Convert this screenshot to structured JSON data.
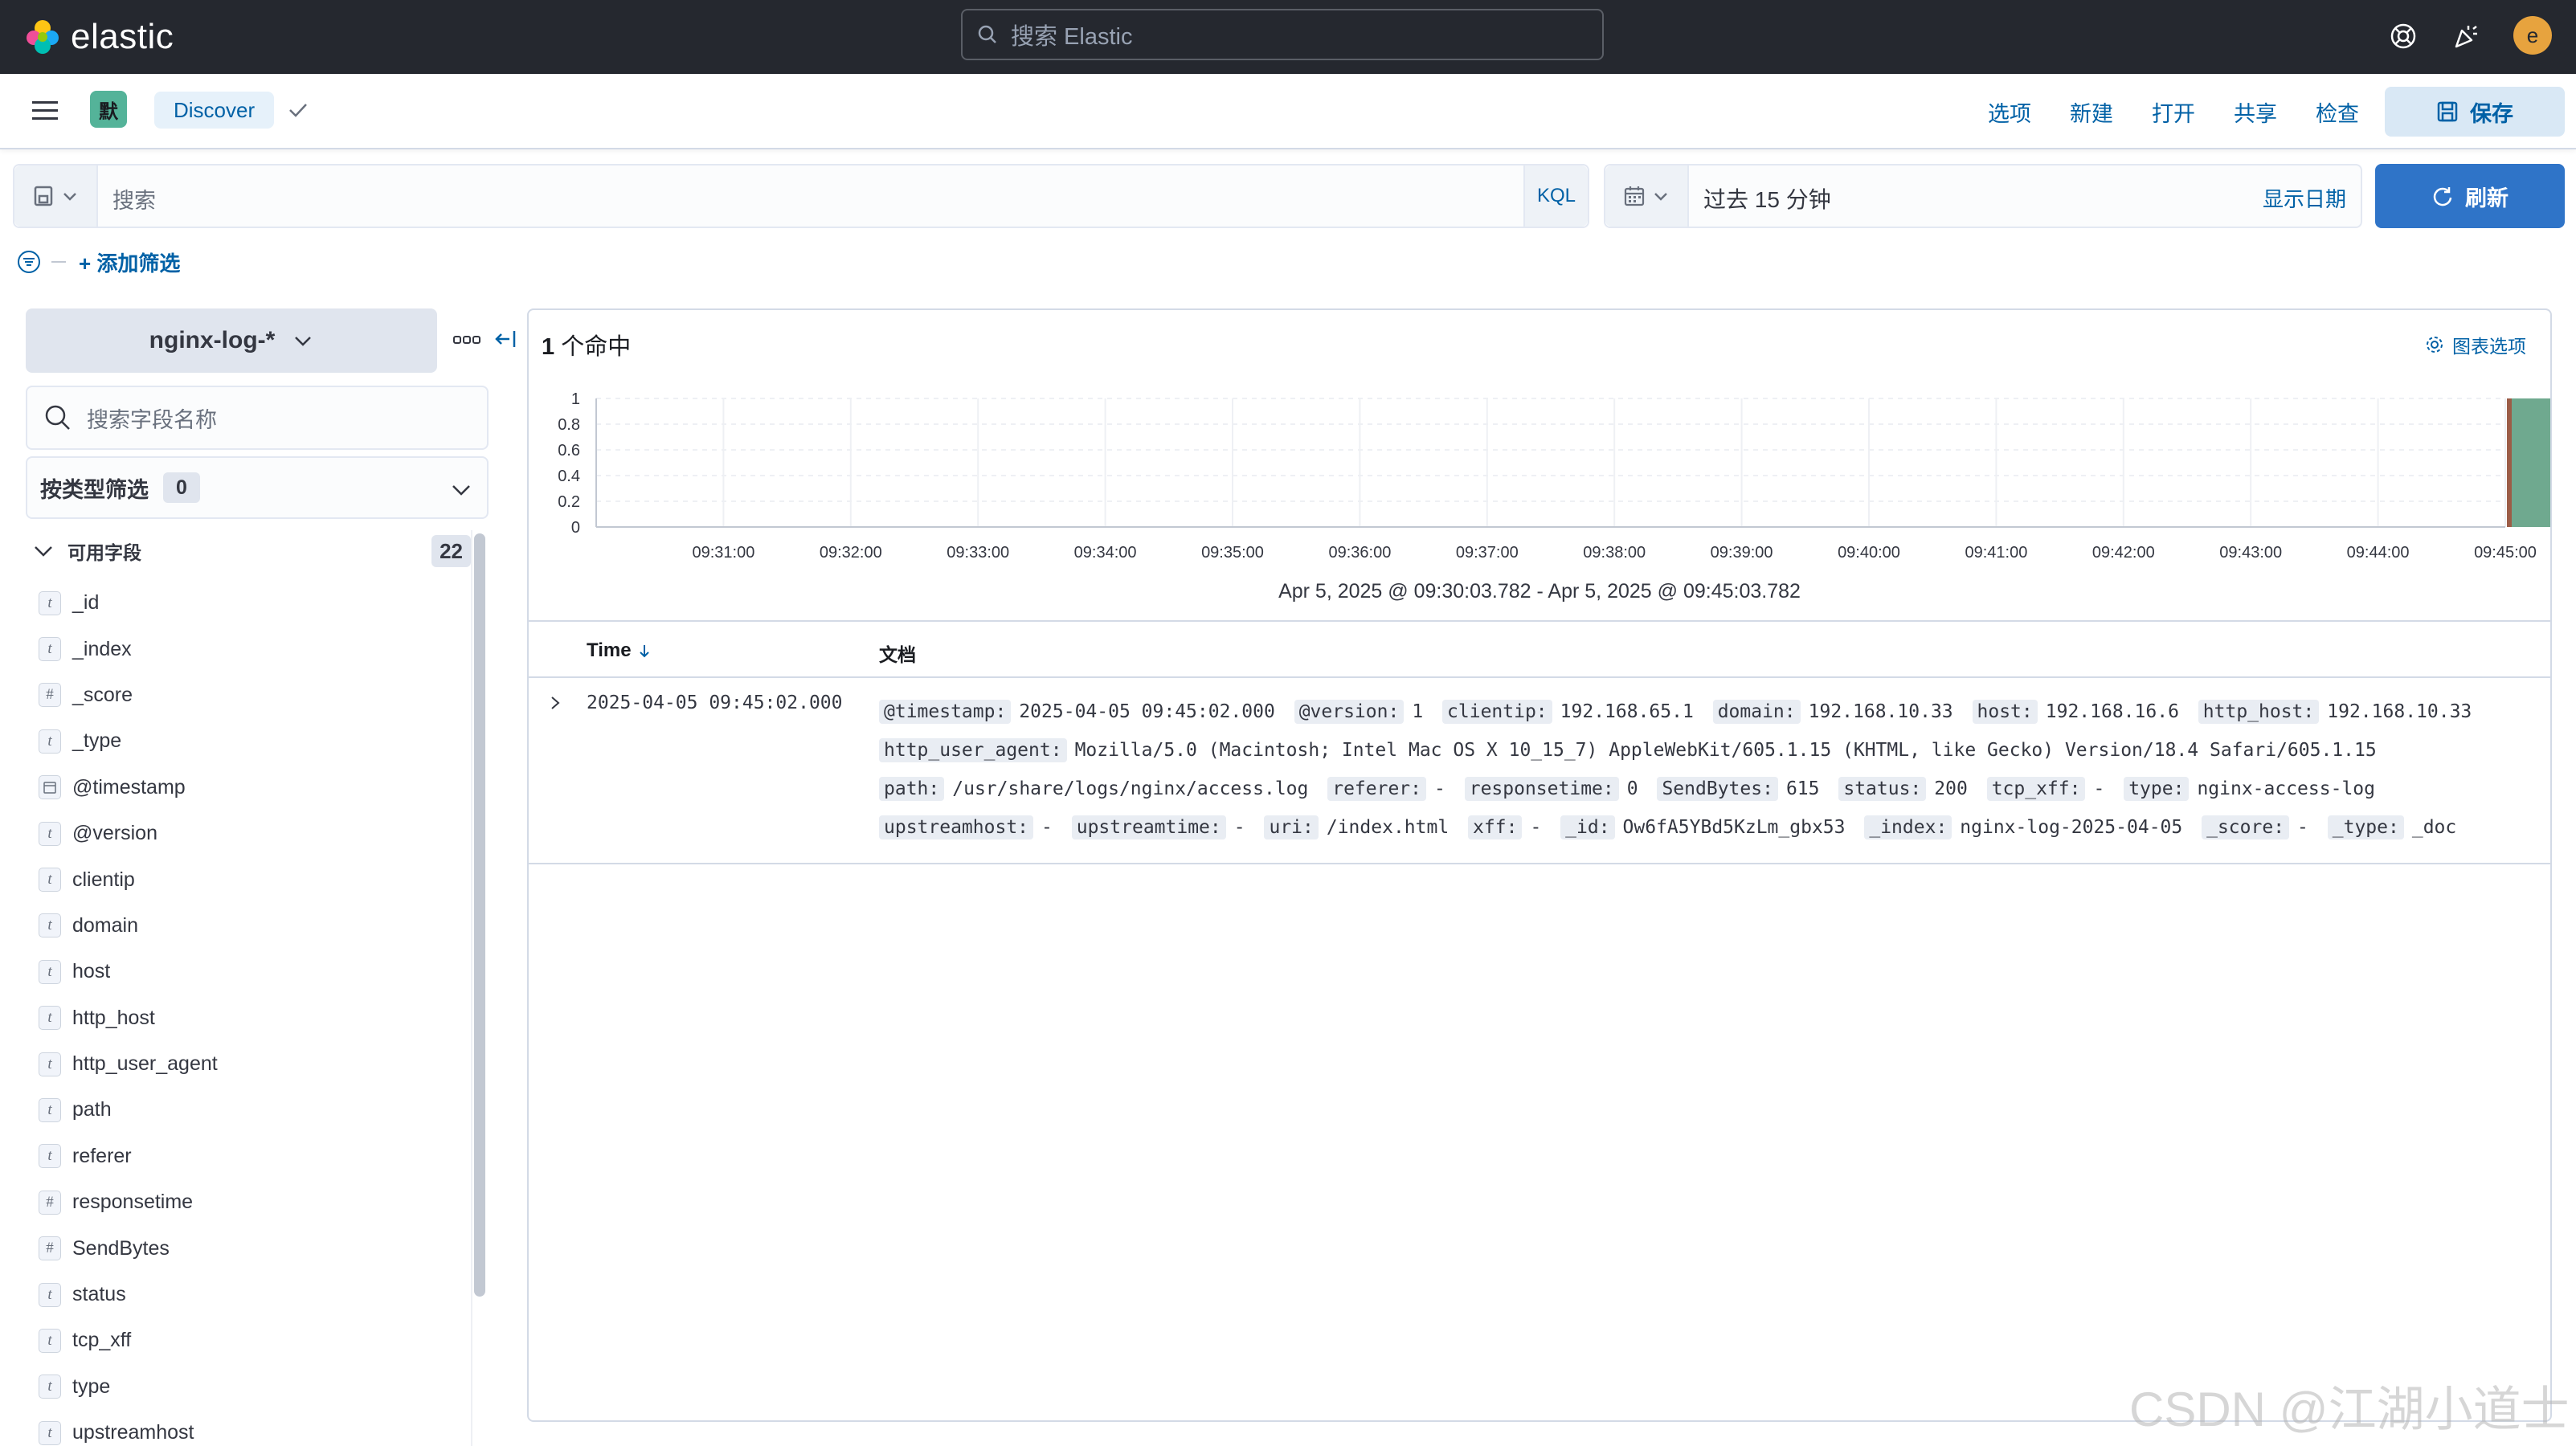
{
  "header": {
    "brand": "elastic",
    "search_placeholder": "搜索 Elastic",
    "avatar_initial": "e"
  },
  "appbar": {
    "space_initial": "默",
    "breadcrumb": "Discover",
    "menu": [
      "选项",
      "新建",
      "打开",
      "共享",
      "检查"
    ],
    "save_label": "保存"
  },
  "querybar": {
    "placeholder": "搜索",
    "language": "KQL",
    "time_range": "过去 15 分钟",
    "show_dates": "显示日期",
    "refresh_label": "刷新",
    "add_filter": "+ 添加筛选"
  },
  "sidebar": {
    "index_pattern": "nginx-log-*",
    "field_search_placeholder": "搜索字段名称",
    "type_filter_label": "按类型筛选",
    "type_filter_count": "0",
    "available_fields_label": "可用字段",
    "available_fields_count": "22",
    "fields": [
      {
        "type": "t",
        "name": "_id"
      },
      {
        "type": "t",
        "name": "_index"
      },
      {
        "type": "#",
        "name": "_score"
      },
      {
        "type": "t",
        "name": "_type"
      },
      {
        "type": "date",
        "name": "@timestamp"
      },
      {
        "type": "t",
        "name": "@version"
      },
      {
        "type": "t",
        "name": "clientip"
      },
      {
        "type": "t",
        "name": "domain"
      },
      {
        "type": "t",
        "name": "host"
      },
      {
        "type": "t",
        "name": "http_host"
      },
      {
        "type": "t",
        "name": "http_user_agent"
      },
      {
        "type": "t",
        "name": "path"
      },
      {
        "type": "t",
        "name": "referer"
      },
      {
        "type": "#",
        "name": "responsetime"
      },
      {
        "type": "#",
        "name": "SendBytes"
      },
      {
        "type": "t",
        "name": "status"
      },
      {
        "type": "t",
        "name": "tcp_xff"
      },
      {
        "type": "t",
        "name": "type"
      },
      {
        "type": "t",
        "name": "upstreamhost"
      }
    ]
  },
  "main": {
    "hits_count": "1",
    "hits_label": " 个命中",
    "chart_options": "图表选项",
    "time_range_text": "Apr 5, 2025 @ 09:30:03.782 - Apr 5, 2025 @ 09:45:03.782",
    "table": {
      "col_time": "Time",
      "col_doc": "文档",
      "rows": [
        {
          "time": "2025-04-05 09:45:02.000",
          "fields": [
            {
              "k": "@timestamp:",
              "v": "2025-04-05 09:45:02.000"
            },
            {
              "k": "@version:",
              "v": "1"
            },
            {
              "k": "clientip:",
              "v": "192.168.65.1"
            },
            {
              "k": "domain:",
              "v": "192.168.10.33"
            },
            {
              "k": "host:",
              "v": "192.168.16.6"
            },
            {
              "k": "http_host:",
              "v": "192.168.10.33"
            },
            {
              "k": "http_user_agent:",
              "v": "Mozilla/5.0 (Macintosh; Intel Mac OS X 10_15_7) AppleWebKit/605.1.15 (KHTML, like Gecko) Version/18.4 Safari/605.1.15"
            },
            {
              "k": "path:",
              "v": "/usr/share/logs/nginx/access.log"
            },
            {
              "k": "referer:",
              "v": "-"
            },
            {
              "k": "responsetime:",
              "v": "0"
            },
            {
              "k": "SendBytes:",
              "v": "615"
            },
            {
              "k": "status:",
              "v": "200"
            },
            {
              "k": "tcp_xff:",
              "v": "-"
            },
            {
              "k": "type:",
              "v": "nginx-access-log"
            },
            {
              "k": "upstreamhost:",
              "v": "-"
            },
            {
              "k": "upstreamtime:",
              "v": "-"
            },
            {
              "k": "uri:",
              "v": "/index.html"
            },
            {
              "k": "xff:",
              "v": "-"
            },
            {
              "k": "_id:",
              "v": "Ow6fA5YBd5KzLm_gbx53"
            },
            {
              "k": "_index:",
              "v": "nginx-log-2025-04-05"
            },
            {
              "k": "_score:",
              "v": "-"
            },
            {
              "k": "_type:",
              "v": "_doc"
            }
          ]
        }
      ]
    }
  },
  "chart_data": {
    "type": "bar",
    "categories": [
      "09:31:00",
      "09:32:00",
      "09:33:00",
      "09:34:00",
      "09:35:00",
      "09:36:00",
      "09:37:00",
      "09:38:00",
      "09:39:00",
      "09:40:00",
      "09:41:00",
      "09:42:00",
      "09:43:00",
      "09:44:00",
      "09:45:00"
    ],
    "x_ticks": [
      "09:31:00",
      "09:32:00",
      "09:33:00",
      "09:34:00",
      "09:35:00",
      "09:36:00",
      "09:37:00",
      "09:38:00",
      "09:39:00",
      "09:40:00",
      "09:41:00",
      "09:42:00",
      "09:43:00",
      "09:44:00",
      "09:45:00"
    ],
    "y_ticks": [
      "0",
      "0.2",
      "0.4",
      "0.6",
      "0.8",
      "1"
    ],
    "bars": [
      {
        "x": "09:45:00",
        "value": 1
      }
    ],
    "ylim": [
      0,
      1
    ],
    "bar_color": "#6fa98f",
    "grid": true
  },
  "watermark": "CSDN @江湖小道士"
}
